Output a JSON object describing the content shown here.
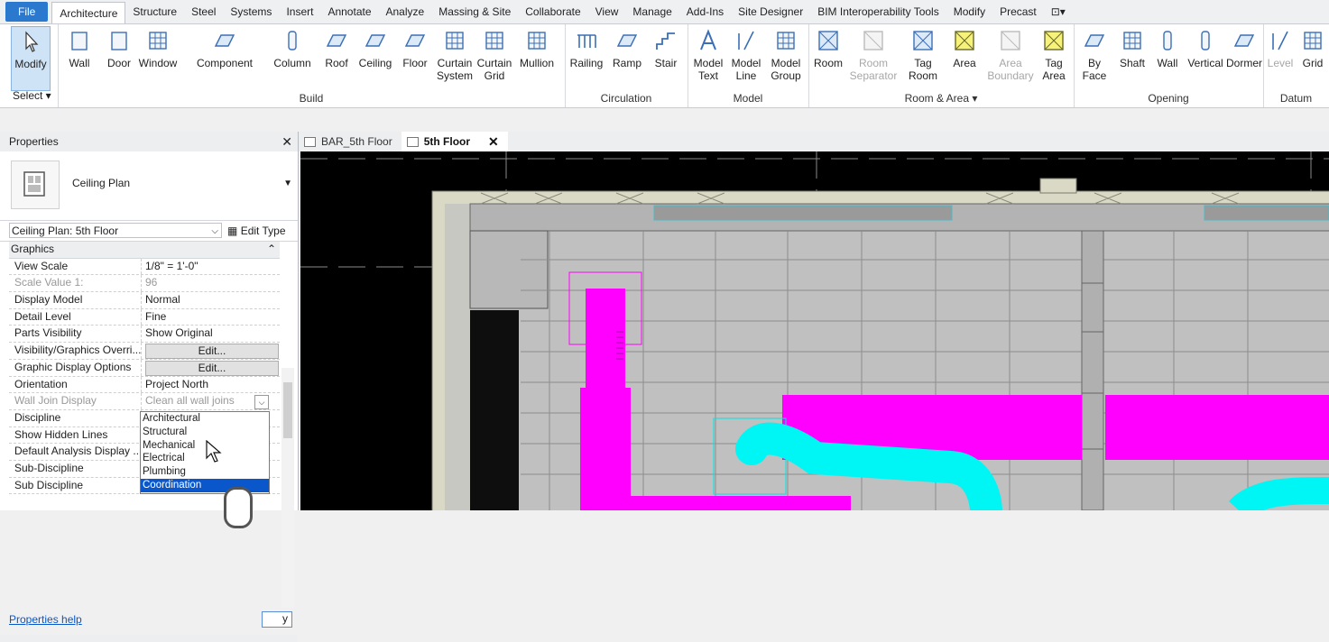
{
  "menu": {
    "file": "File",
    "tabs": [
      "Architecture",
      "Structure",
      "Steel",
      "Systems",
      "Insert",
      "Annotate",
      "Analyze",
      "Massing & Site",
      "Collaborate",
      "View",
      "Manage",
      "Add-Ins",
      "Site Designer",
      "BIM Interoperability Tools",
      "Modify",
      "Precast"
    ],
    "active_tab": "Architecture"
  },
  "ribbon": {
    "select": {
      "modify": "Modify",
      "label": "Select ▾"
    },
    "build": {
      "label": "Build",
      "buttons": [
        "Wall",
        "Door",
        "Window",
        "Component",
        "Column",
        "Roof",
        "Ceiling",
        "Floor",
        "Curtain System",
        "Curtain Grid",
        "Mullion"
      ]
    },
    "circulation": {
      "label": "Circulation",
      "buttons": [
        "Railing",
        "Ramp",
        "Stair"
      ]
    },
    "model": {
      "label": "Model",
      "buttons": [
        "Model Text",
        "Model Line",
        "Model Group"
      ]
    },
    "room_area": {
      "label": "Room & Area ▾",
      "buttons": [
        "Room",
        "Room Separator",
        "Tag Room",
        "Area",
        "Area Boundary",
        "Tag Area"
      ]
    },
    "opening": {
      "label": "Opening",
      "buttons": [
        "By Face",
        "Shaft",
        "Wall",
        "Vertical",
        "Dormer"
      ]
    },
    "datum": {
      "label": "Datum",
      "buttons": [
        "Level",
        "Grid"
      ]
    }
  },
  "properties": {
    "title": "Properties",
    "type_name": "Ceiling Plan",
    "instance": "Ceiling Plan: 5th Floor",
    "edit_type": "Edit Type",
    "section": "Graphics",
    "rows": [
      {
        "key": "View Scale",
        "value": "1/8\" = 1'-0\"",
        "dim": false
      },
      {
        "key": "Scale Value    1:",
        "value": "96",
        "dim": true
      },
      {
        "key": "Display Model",
        "value": "Normal",
        "dim": false
      },
      {
        "key": "Detail Level",
        "value": "Fine",
        "dim": false
      },
      {
        "key": "Parts Visibility",
        "value": "Show Original",
        "dim": false
      },
      {
        "key": "Visibility/Graphics Overri...",
        "value": "Edit...",
        "button": true,
        "dim": false
      },
      {
        "key": "Graphic Display Options",
        "value": "Edit...",
        "button": true,
        "dim": false
      },
      {
        "key": "Orientation",
        "value": "Project North",
        "dim": false
      },
      {
        "key": "Wall Join Display",
        "value": "Clean all wall joins",
        "dim": true
      },
      {
        "key": "Discipline",
        "value": "Coordination",
        "selected": true,
        "dim": false
      },
      {
        "key": "Show Hidden Lines",
        "value": "",
        "dim": false
      },
      {
        "key": "Default Analysis Display ...",
        "value": "",
        "dim": false
      },
      {
        "key": "Sub-Discipline",
        "value": "",
        "dim": false
      },
      {
        "key": "Sub Discipline",
        "value": "",
        "dim": false
      }
    ],
    "discipline_options": [
      "Architectural",
      "Structural",
      "Mechanical",
      "Electrical",
      "Plumbing",
      "Coordination"
    ],
    "discipline_selected": "Coordination",
    "help": "Properties help",
    "apply": "y"
  },
  "view_tabs": [
    {
      "label": "BAR_5th Floor",
      "active": false
    },
    {
      "label": "5th Floor",
      "active": true
    }
  ],
  "colors": {
    "accent": "#2b78cf",
    "duct_magenta": "#ff00ff",
    "pipe_cyan": "#00f5f5",
    "slab_gray": "#c0c0c0",
    "wall_tan": "#d9d9c6"
  }
}
